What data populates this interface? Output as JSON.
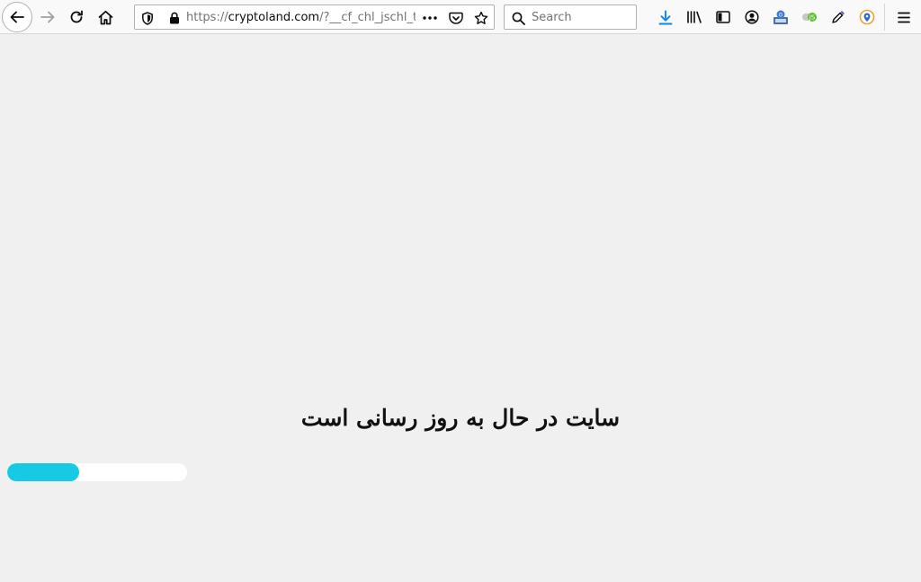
{
  "browser": {
    "url_prefix": "https://",
    "url_host": "cryptoland.com",
    "url_path": "/?__cf_chl_jschl_tk_",
    "search_placeholder": "Search"
  },
  "icons": {
    "back": "back-arrow-icon",
    "forward": "forward-arrow-icon",
    "reload": "reload-icon",
    "home": "home-icon",
    "tracking": "shield-icon",
    "lock": "lock-icon",
    "page_actions": "more-icon",
    "pocket": "pocket-icon",
    "bookmark": "star-icon",
    "search": "magnifier-icon",
    "downloads": "download-icon",
    "library": "library-icon",
    "sidebar": "sidebar-icon",
    "account": "account-icon",
    "ext1": "extension-icon",
    "ext2": "extension-icon",
    "eyedropper": "eyedropper-icon",
    "ext3": "extension-icon",
    "menu": "hamburger-menu-icon"
  },
  "page": {
    "status_message": "سایت در حال به روز رسانی است",
    "progress_fraction": 0.4,
    "progress_color": "#17c9e3",
    "background_color": "#f0f0f0"
  }
}
